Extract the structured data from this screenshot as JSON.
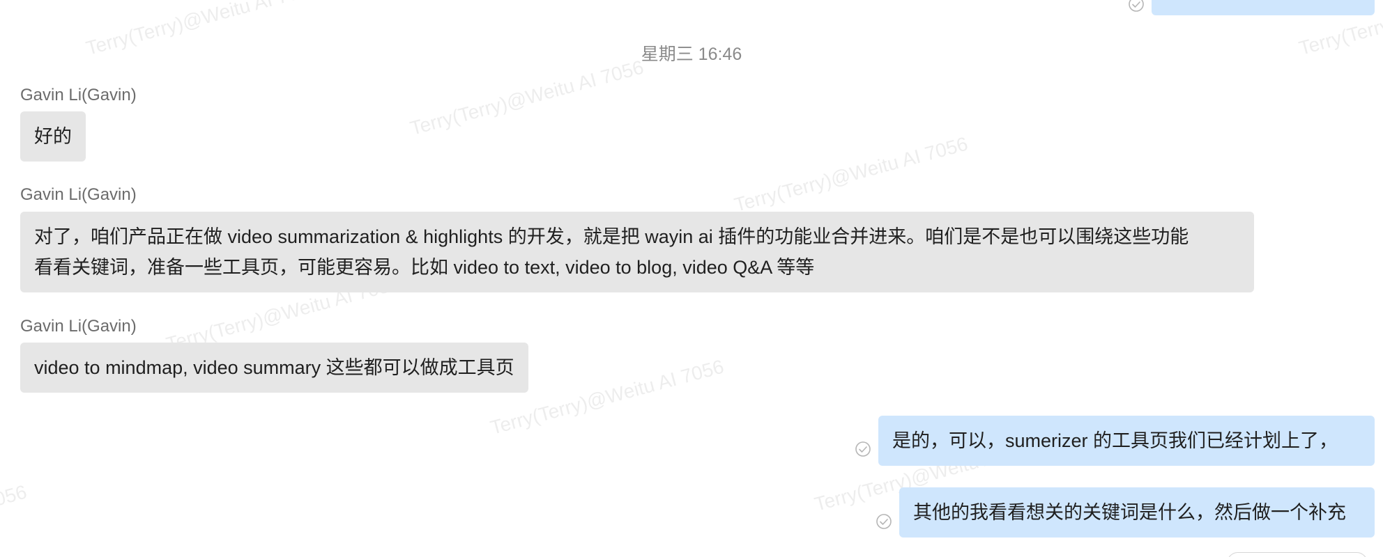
{
  "watermark_text": "Terry(Terry)@Weitu AI 7056",
  "timestamp": "星期三 16:46",
  "messages": [
    {
      "sender": "Gavin Li(Gavin)",
      "text": "好的"
    },
    {
      "sender": "Gavin Li(Gavin)",
      "lines": [
        "对了，咱们产品正在做 video summarization & highlights 的开发，就是把 wayin ai 插件的功能业合并进来。咱们是不是也可以围绕这些功能",
        "看看关键词，准备一些工具页，可能更容易。比如 video to text, video to blog, video Q&A 等等"
      ]
    },
    {
      "sender": "Gavin Li(Gavin)",
      "text": "video to mindmap, video summary 这些都可以做成工具页"
    }
  ],
  "outgoing": [
    {
      "text": "是的，可以，sumerizer 的工具页我们已经计划上了，"
    },
    {
      "text": "其他的我看看想关的关键词是什么，然后做一个补充"
    }
  ],
  "colors": {
    "incoming_bubble": "#e6e6e6",
    "outgoing_bubble": "#cfe6fd",
    "read_icon": "#b5b5b5"
  },
  "icons": {
    "read_receipt": "read-check-icon"
  }
}
